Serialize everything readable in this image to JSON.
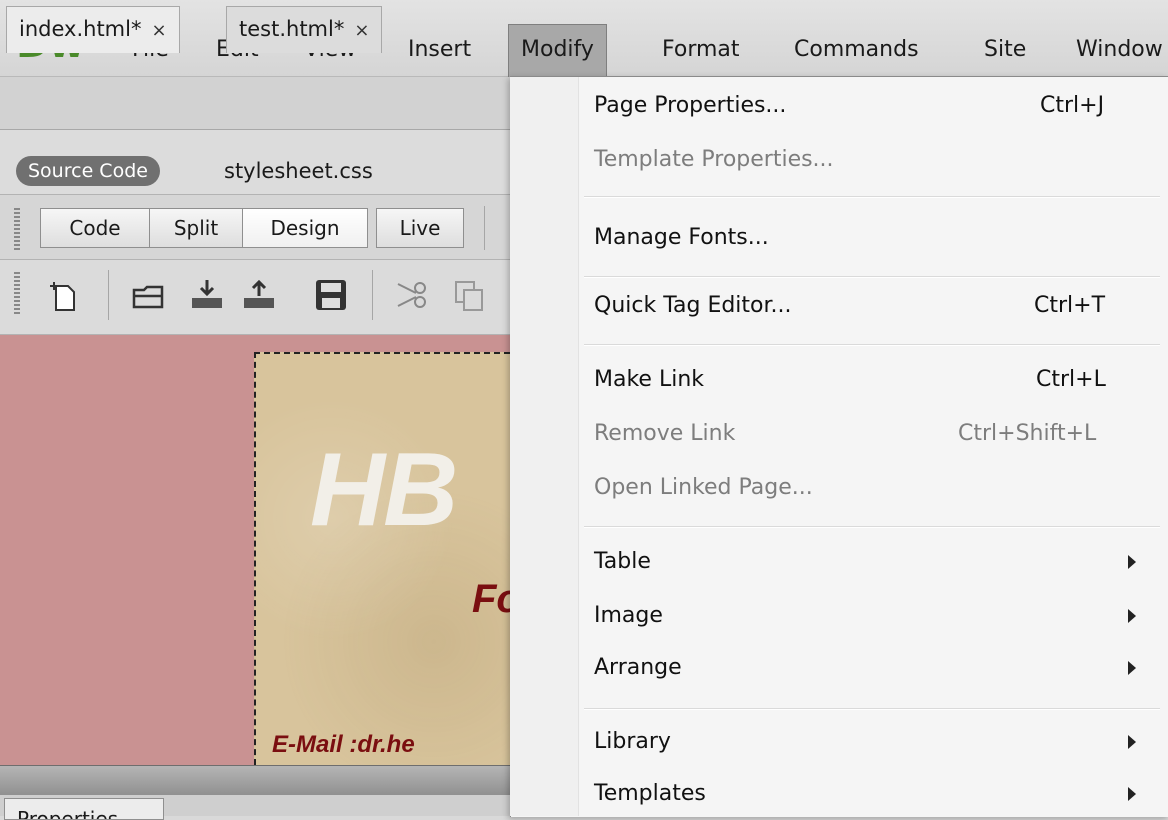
{
  "app": {
    "logo": "Dw"
  },
  "menubar": {
    "items": [
      "File",
      "Edit",
      "View",
      "Insert",
      "Modify",
      "Format",
      "Commands",
      "Site",
      "Window"
    ],
    "active": "Modify"
  },
  "document_tabs": [
    {
      "label": "index.html*",
      "close": "×"
    },
    {
      "label": "test.html*",
      "close": "×"
    }
  ],
  "related_files": {
    "source_code": "Source Code",
    "file": "stylesheet.css"
  },
  "view_buttons": {
    "code": "Code",
    "split": "Split",
    "design": "Design",
    "live": "Live"
  },
  "canvas": {
    "hb": "HB",
    "fo": "Fo",
    "email": "E-Mail :dr.he"
  },
  "panel": {
    "properties_tab": "Properties"
  },
  "modify_menu": {
    "items": [
      {
        "label": "Page Properties...",
        "shortcut": "Ctrl+J",
        "enabled": true
      },
      {
        "label": "Template Properties...",
        "shortcut": "",
        "enabled": false
      },
      {
        "label": "Manage Fonts...",
        "shortcut": "",
        "enabled": true
      },
      {
        "label": "Quick Tag Editor...",
        "shortcut": "Ctrl+T",
        "enabled": true
      },
      {
        "label": "Make Link",
        "shortcut": "Ctrl+L",
        "enabled": true
      },
      {
        "label": "Remove Link",
        "shortcut": "Ctrl+Shift+L",
        "enabled": false
      },
      {
        "label": "Open Linked Page...",
        "shortcut": "",
        "enabled": false
      },
      {
        "label": "Table",
        "submenu": true,
        "enabled": true
      },
      {
        "label": "Image",
        "submenu": true,
        "enabled": true
      },
      {
        "label": "Arrange",
        "submenu": true,
        "enabled": true
      },
      {
        "label": "Library",
        "submenu": true,
        "enabled": true
      },
      {
        "label": "Templates",
        "submenu": true,
        "enabled": true
      }
    ]
  },
  "colors": {
    "logo": "#4a8a2a",
    "canvas_bg": "#c99292",
    "card_bg": "#d8c49c",
    "accent_text": "#7a0e10"
  }
}
